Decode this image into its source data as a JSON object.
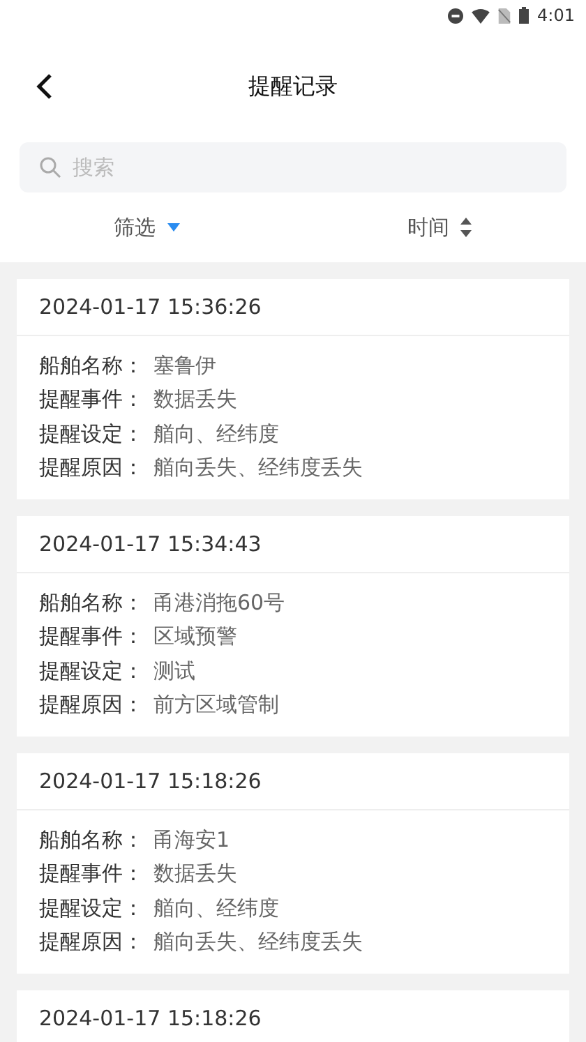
{
  "status_bar": {
    "time": "4:01"
  },
  "header": {
    "title": "提醒记录"
  },
  "search": {
    "placeholder": "搜索"
  },
  "toolbar": {
    "filter": "筛选",
    "sort": "时间"
  },
  "records": [
    {
      "time": "2024-01-17 15:36:26",
      "fields": [
        {
          "label": "船舶名称：",
          "value": "塞鲁伊"
        },
        {
          "label": "提醒事件：",
          "value": "数据丢失"
        },
        {
          "label": "提醒设定：",
          "value": "艏向、经纬度"
        },
        {
          "label": "提醒原因：",
          "value": "艏向丢失、经纬度丢失"
        }
      ]
    },
    {
      "time": "2024-01-17 15:34:43",
      "fields": [
        {
          "label": "船舶名称：",
          "value": "甬港消拖60号"
        },
        {
          "label": "提醒事件：",
          "value": "区域预警"
        },
        {
          "label": "提醒设定：",
          "value": "测试"
        },
        {
          "label": "提醒原因：",
          "value": "前方区域管制"
        }
      ]
    },
    {
      "time": "2024-01-17 15:18:26",
      "fields": [
        {
          "label": "船舶名称：",
          "value": "甬海安1"
        },
        {
          "label": "提醒事件：",
          "value": "数据丢失"
        },
        {
          "label": "提醒设定：",
          "value": "艏向、经纬度"
        },
        {
          "label": "提醒原因：",
          "value": "艏向丢失、经纬度丢失"
        }
      ]
    },
    {
      "time": "2024-01-17 15:18:26"
    }
  ]
}
